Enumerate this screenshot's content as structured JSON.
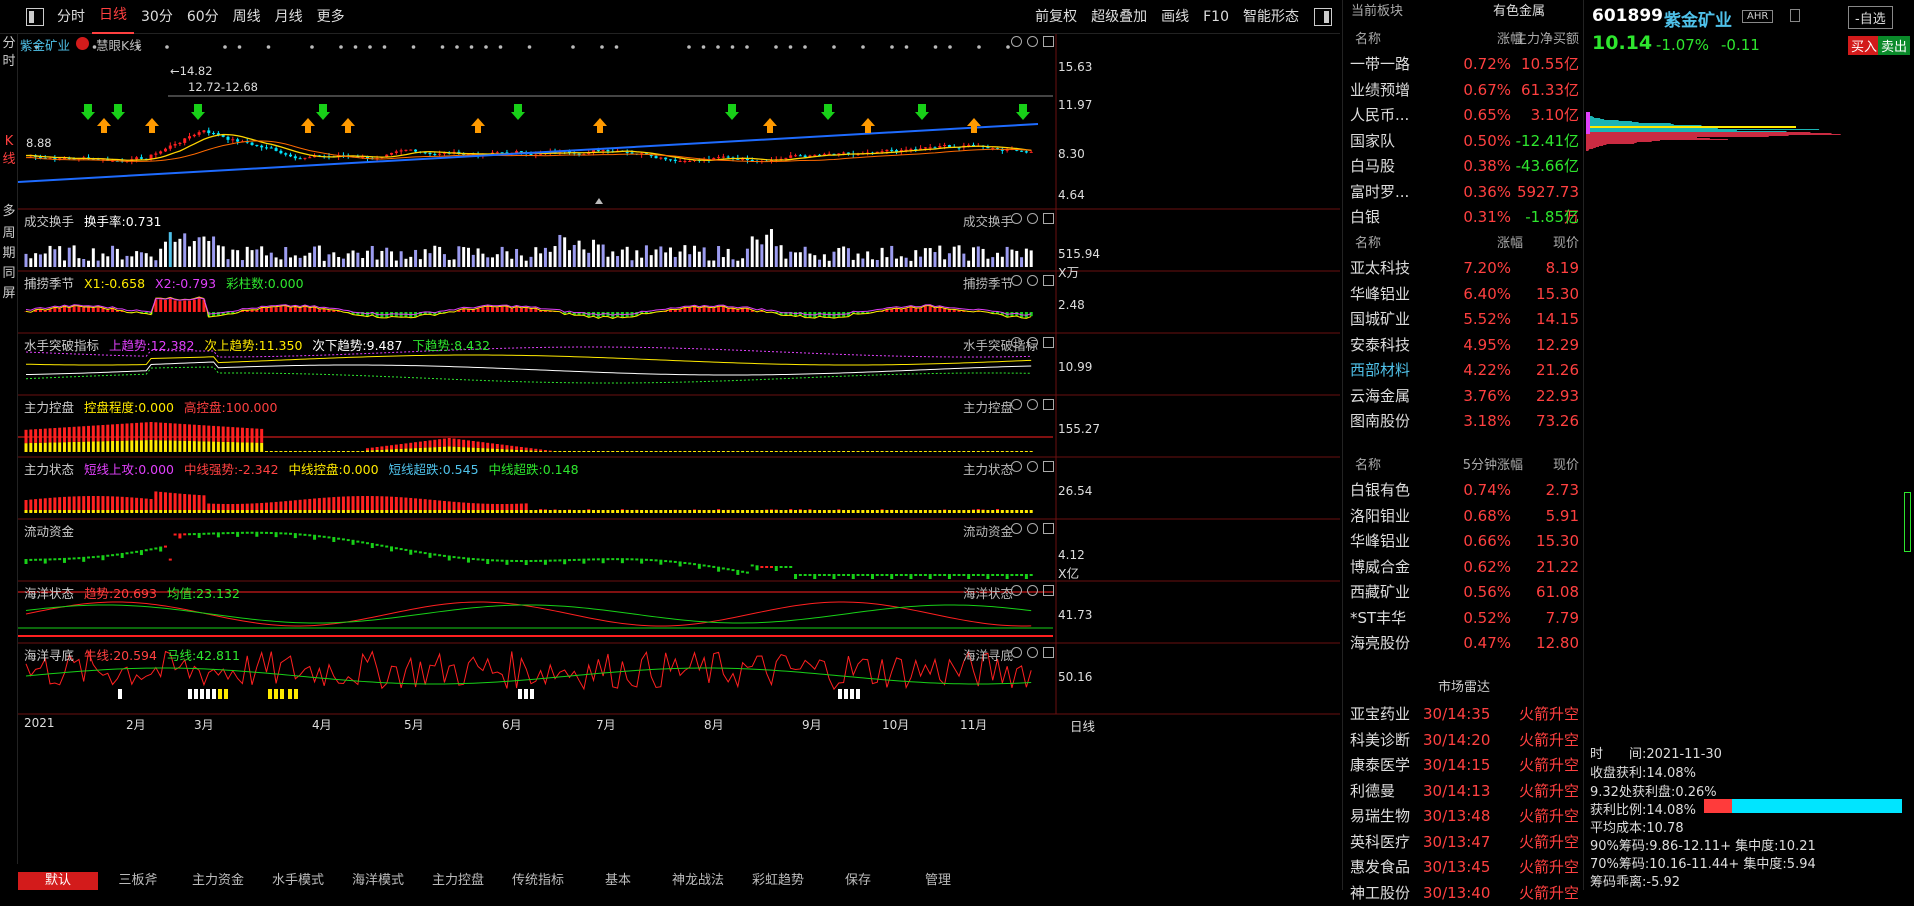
{
  "toolbar": {
    "items": [
      "分时",
      "日线",
      "30分",
      "60分",
      "周线",
      "月线",
      "更多"
    ],
    "active": "日线",
    "right_items": [
      "前复权",
      "超级叠加",
      "画线",
      "F10",
      "智能形态"
    ]
  },
  "left_nav": [
    "分",
    "时",
    "K",
    "线",
    "多",
    "周",
    "期",
    "同",
    "屏"
  ],
  "kline": {
    "stock_name": "紫金矿业",
    "chart_type": "慧眼K线",
    "high_label": "←14.82",
    "range_label": "12.72-12.68",
    "low_label": "8.88",
    "y_ticks": [
      "15.63",
      "11.97",
      "8.30",
      "4.64"
    ],
    "colors": {
      "up": "#ff2020",
      "down": "#00e5ff",
      "ma": "#ffd400",
      "ma_long": "#1e6bff"
    }
  },
  "panels": [
    {
      "id": "vol",
      "title": "成交换手",
      "indicators": [
        {
          "label": "换手率:0.731",
          "color": "#ffffff"
        }
      ],
      "right": "成交换手",
      "y_ticks": [
        "515.94"
      ],
      "unit": "X万"
    },
    {
      "id": "bl",
      "title": "捕捞季节",
      "indicators": [
        {
          "label": "X1:-0.658",
          "color": "#ffea00"
        },
        {
          "label": "X2:-0.793",
          "color": "#e040fb"
        },
        {
          "label": "彩柱数:0.000",
          "color": "#2ee62e"
        }
      ],
      "right": "捕捞季节",
      "y_ticks": [
        "2.48"
      ],
      "unit": ""
    },
    {
      "id": "ss",
      "title": "水手突破指标",
      "indicators": [
        {
          "label": "上趋势:12.382",
          "color": "#e040fb"
        },
        {
          "label": "次上趋势:11.350",
          "color": "#ffea00"
        },
        {
          "label": "次下趋势:9.487",
          "color": "#ffffff"
        },
        {
          "label": "下趋势:8.432",
          "color": "#2ee62e"
        }
      ],
      "right": "水手突破指标",
      "y_ticks": [
        "10.99"
      ],
      "unit": ""
    },
    {
      "id": "zlkp",
      "title": "主力控盘",
      "indicators": [
        {
          "label": "控盘程度:0.000",
          "color": "#ffea00"
        },
        {
          "label": "高控盘:100.000",
          "color": "#ff4040"
        }
      ],
      "right": "主力控盘",
      "y_ticks": [
        "155.27"
      ],
      "unit": ""
    },
    {
      "id": "zlzt",
      "title": "主力状态",
      "indicators": [
        {
          "label": "短线上攻:0.000",
          "color": "#e040fb"
        },
        {
          "label": "中线强势:-2.342",
          "color": "#ff4040"
        },
        {
          "label": "中线控盘:0.000",
          "color": "#ffea00"
        },
        {
          "label": "短线超跌:0.545",
          "color": "#4fc1e9"
        },
        {
          "label": "中线超跌:0.148",
          "color": "#2ee62e"
        }
      ],
      "right": "主力状态",
      "y_ticks": [
        "26.54"
      ],
      "unit": ""
    },
    {
      "id": "ldzj",
      "title": "流动资金",
      "indicators": [],
      "right": "流动资金",
      "y_ticks": [
        "4.12"
      ],
      "unit": "X亿"
    },
    {
      "id": "hyzt",
      "title": "海洋状态",
      "indicators": [
        {
          "label": "趋势:20.693",
          "color": "#ff4040"
        },
        {
          "label": "均值:23.132",
          "color": "#2ee62e"
        }
      ],
      "right": "海洋状态",
      "y_ticks": [
        "41.73"
      ],
      "unit": ""
    },
    {
      "id": "hyxd",
      "title": "海洋寻底",
      "indicators": [
        {
          "label": "牛线:20.594",
          "color": "#ff4040"
        },
        {
          "label": "马线:42.811",
          "color": "#2ee62e"
        }
      ],
      "right": "海洋寻底",
      "y_ticks": [
        "50.16"
      ],
      "unit": ""
    }
  ],
  "x_axis": [
    "2021",
    "2月",
    "3月",
    "4月",
    "5月",
    "6月",
    "7月",
    "8月",
    "9月",
    "10月",
    "11月"
  ],
  "x_axis_right": "日线",
  "bottom_tabs": [
    "默认",
    "三板斧",
    "主力资金",
    "水手模式",
    "海洋模式",
    "主力控盘",
    "传统指标",
    "基本",
    "神龙战法",
    "彩虹趋势",
    "保存",
    "管理"
  ],
  "sector": {
    "header_left": "当前板块",
    "header_right": "有色金属",
    "cols": [
      "名称",
      "涨幅",
      "主力净买额"
    ],
    "rows": [
      [
        "一带一路",
        "0.72%",
        "10.55亿"
      ],
      [
        "业绩预增",
        "0.67%",
        "61.33亿"
      ],
      [
        "人民币...",
        "0.65%",
        "3.10亿"
      ],
      [
        "国家队",
        "0.50%",
        "-12.41亿"
      ],
      [
        "白马股",
        "0.38%",
        "-43.66亿"
      ],
      [
        "富时罗...",
        "0.36%",
        "5927.73万"
      ],
      [
        "白银",
        "0.31%",
        "-1.85亿"
      ]
    ]
  },
  "leaders": {
    "cols": [
      "名称",
      "涨幅",
      "现价"
    ],
    "rows": [
      [
        "亚太科技",
        "7.20%",
        "8.19"
      ],
      [
        "华峰铝业",
        "6.40%",
        "15.30"
      ],
      [
        "国城矿业",
        "5.52%",
        "14.15"
      ],
      [
        "安泰科技",
        "4.95%",
        "12.29"
      ],
      [
        "西部材料",
        "4.22%",
        "21.26"
      ],
      [
        "云海金属",
        "3.76%",
        "22.93"
      ],
      [
        "图南股份",
        "3.18%",
        "73.26"
      ]
    ]
  },
  "fivemin": {
    "cols": [
      "名称",
      "5分钟涨幅",
      "现价"
    ],
    "rows": [
      [
        "白银有色",
        "0.74%",
        "2.73"
      ],
      [
        "洛阳钼业",
        "0.68%",
        "5.91"
      ],
      [
        "华峰铝业",
        "0.66%",
        "15.30"
      ],
      [
        "博威合金",
        "0.62%",
        "21.22"
      ],
      [
        "西藏矿业",
        "0.56%",
        "61.08"
      ],
      [
        "*ST丰华",
        "0.52%",
        "7.79"
      ],
      [
        "海亮股份",
        "0.47%",
        "12.80"
      ]
    ]
  },
  "radar": {
    "title": "市场雷达",
    "rows": [
      [
        "亚宝药业",
        "30/14:35",
        "火箭升空"
      ],
      [
        "科美诊断",
        "30/14:20",
        "火箭升空"
      ],
      [
        "康泰医学",
        "30/14:15",
        "火箭升空"
      ],
      [
        "利德曼",
        "30/14:13",
        "火箭升空"
      ],
      [
        "易瑞生物",
        "30/13:48",
        "火箭升空"
      ],
      [
        "英科医疗",
        "30/13:47",
        "火箭升空"
      ],
      [
        "惠发食品",
        "30/13:45",
        "火箭升空"
      ],
      [
        "神工股份",
        "30/13:40",
        "火箭升空"
      ]
    ]
  },
  "quote": {
    "code": "601899",
    "name": "紫金矿业",
    "tag": "AHR",
    "watch": "-自选",
    "price": "10.14",
    "change_pct": "-1.07%",
    "change": "-0.11",
    "buy": "买入",
    "sell": "卖出"
  },
  "chip": {
    "time_label": "时　　间:2021-11-30",
    "profit_ratio": "收盘获利:14.08%",
    "profit_at": "9.32处获利盘:0.26%",
    "profit_label": "获利比例:14.08%",
    "profit_fraction": 0.14,
    "avg_cost": "平均成本:10.78",
    "c90": "90%筹码:9.86-12.11+ 集中度:10.21",
    "c70": "70%筹码:10.16-11.44+ 集中度:5.94",
    "divergence": "筹码乖离:-5.92"
  }
}
